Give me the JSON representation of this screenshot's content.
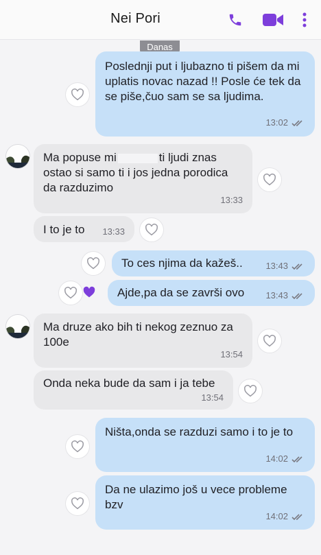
{
  "header": {
    "contact_name": "Nei Pori",
    "icons": [
      "phone-icon",
      "video-call-icon",
      "more-options-icon"
    ],
    "accent_color": "#7d3edb"
  },
  "date_divider": "Danas",
  "messages": [
    {
      "direction": "out",
      "text": "Poslednji put i ljubazno ti pišem da mi uplatis novac nazad !! Posle će tek da se piše,čuo sam se sa ljudima.",
      "time": "13:02",
      "status": "delivered"
    },
    {
      "direction": "in",
      "text_before": "Ma popuse mi",
      "text_after": "ti ljudi znas ostao si samo ti i jos jedna porodica da razduzimo",
      "time": "13:33",
      "redacted": true
    },
    {
      "direction": "in",
      "text": "I to je to",
      "time": "13:33"
    },
    {
      "direction": "out",
      "text": "To ces njima da kažeš..",
      "time": "13:43",
      "status": "delivered"
    },
    {
      "direction": "out",
      "text": "Ajde,pa da se završi ovo",
      "time": "13:43",
      "status": "delivered",
      "reaction": "liked"
    },
    {
      "direction": "in",
      "text": "Ma druze ako bih ti nekog zeznuo za 100e",
      "time": "13:54"
    },
    {
      "direction": "in",
      "text": "Onda neka bude da sam i ja tebe",
      "time": "13:54"
    },
    {
      "direction": "out",
      "text": "Ništa,onda se razduzi samo i to je to",
      "time": "14:02",
      "status": "delivered"
    },
    {
      "direction": "out",
      "text": "Da ne ulazimo još u vece probleme bzv",
      "time": "14:02",
      "status": "delivered"
    }
  ]
}
